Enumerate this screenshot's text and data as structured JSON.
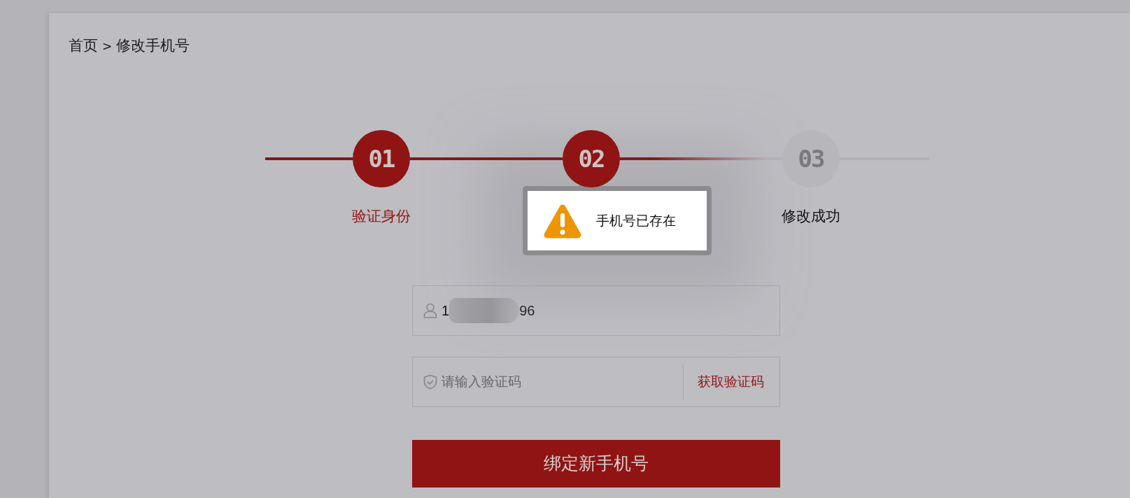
{
  "breadcrumb": {
    "home": "首页",
    "separator": ">",
    "current": "修改手机号"
  },
  "steps": [
    {
      "number": "01",
      "label": "验证身份",
      "active": true
    },
    {
      "number": "02",
      "active": true
    },
    {
      "number": "03",
      "label": "修改成功",
      "active": false
    }
  ],
  "phone_field": {
    "value_start": "1",
    "value_end": "96",
    "masked": true
  },
  "code_field": {
    "placeholder": "请输入验证码",
    "action": "获取验证码"
  },
  "submit_button": "绑定新手机号",
  "alert": {
    "message": "手机号已存在",
    "kind": "warning"
  }
}
